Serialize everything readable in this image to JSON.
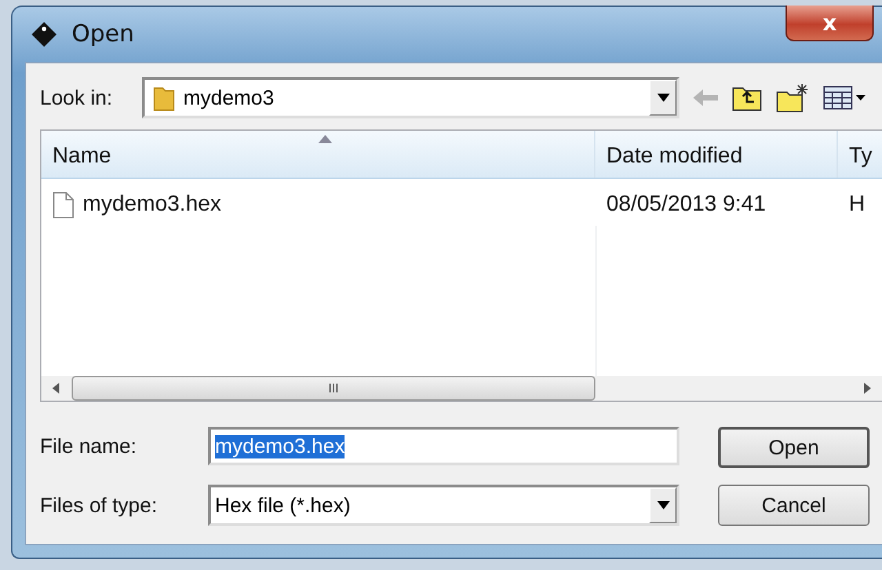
{
  "window": {
    "title": "Open",
    "close_label": "x"
  },
  "look_in": {
    "label": "Look in:",
    "value": "mydemo3"
  },
  "file_list": {
    "columns": [
      {
        "label": "Name",
        "sorted": true
      },
      {
        "label": "Date modified",
        "sorted": false
      },
      {
        "label": "Ty",
        "sorted": false
      }
    ],
    "rows": [
      {
        "cells": [
          "mydemo3.hex",
          "08/05/2013 9:41",
          "H"
        ],
        "selected": false
      }
    ]
  },
  "scrollbar_grip": "III",
  "file_name": {
    "label": "File name:",
    "value": "mydemo3.hex",
    "text_selected": true
  },
  "file_type": {
    "label": "Files of type:",
    "value": "Hex file (*.hex)"
  },
  "buttons": [
    {
      "label": "Open",
      "kind": "default"
    },
    {
      "label": "Cancel",
      "kind": "normal"
    }
  ]
}
